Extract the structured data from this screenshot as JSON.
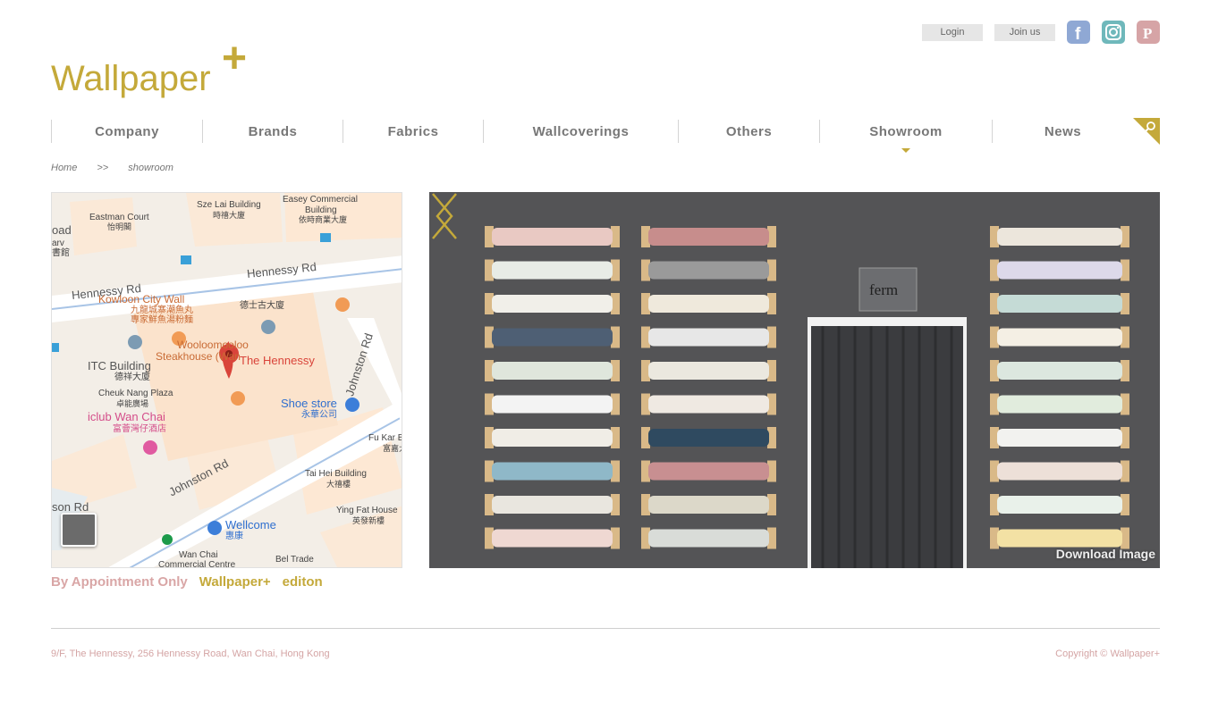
{
  "top": {
    "login_label": "Login",
    "join_label": "Join us",
    "social": [
      "facebook-icon",
      "instagram-icon",
      "pinterest-icon"
    ]
  },
  "logo": {
    "text": "Wallpaper",
    "plus": "+"
  },
  "nav": {
    "items": [
      "Company",
      "Brands",
      "Fabrics",
      "Wallcoverings",
      "Others",
      "Showroom",
      "News"
    ],
    "active": "Showroom"
  },
  "breadcrumb": {
    "home": "Home",
    "separator": ">>",
    "current": "showroom"
  },
  "map": {
    "labels": {
      "sze_lai": "Sze Lai Building",
      "sze_lai_zh": "時禧大廈",
      "easey": "Easey Commercial",
      "easey2": "Building",
      "easey_zh": "依時商業大廈",
      "eastman": "Eastman Court",
      "eastman_zh": "怡明閣",
      "road_frag": "oad",
      "arv_frag": "arv",
      "lib_frag": "書館",
      "hennessy_rd1": "Hennessy Rd",
      "hennessy_rd2": "Hennessy Rd",
      "kowloon_city": "Kowloon City Wall",
      "kowloon_zh1": "九龍城寨潮魚丸",
      "kowloon_zh2": "專家鮮魚湯粉麵",
      "tak_sze": "德士古大廈",
      "wooloo": "Wooloomooloo",
      "steakhouse": "Steakhouse (Wan",
      "the_hennessy": "The Hennessy",
      "itc": "ITC Building",
      "itc_zh": "德祥大廈",
      "johnston_rd1": "Johnston Rd",
      "cheuk_nang": "Cheuk Nang Plaza",
      "cheuk_nang_zh": "卓能廣場",
      "shoe_store": "Shoe store",
      "shoe_zh": "永華公司",
      "iclub": "iclub Wan Chai",
      "iclub_zh": "富薈灣仔酒店",
      "fu_kar": "Fu Kar Bi",
      "fu_kar_zh": "富嘉大",
      "tai_hei": "Tai Hei Building",
      "tai_hei_zh": "大禧樓",
      "johnston_rd2": "Johnston Rd",
      "son_rd": "son Rd",
      "ying_fat": "Ying Fat House",
      "ying_fat_zh": "英發新樓",
      "wellcome": "Wellcome",
      "wellcome_zh": "惠康",
      "wan_chai_cc": "Wan Chai",
      "wan_chai_cc2": "Commercial Centre",
      "bel_trade": "Bel Trade"
    }
  },
  "gallery": {
    "sign": "ferm",
    "download_label": "Download Image"
  },
  "caption": {
    "part1": "By Appointment Only",
    "part2": "Wallpaper+",
    "part3": "editon"
  },
  "footer": {
    "address": "9/F, The Hennessy, 256 Hennessy Road, Wan Chai, Hong Kong",
    "copyright": "Copyright © Wallpaper+"
  },
  "colors": {
    "gold": "#c4a93a",
    "pink": "#d4a4a4",
    "nav_text": "#777777"
  }
}
